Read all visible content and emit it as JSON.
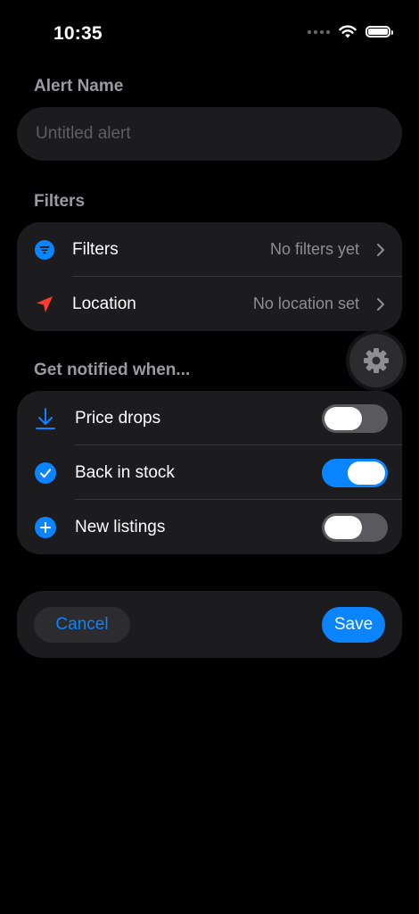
{
  "status_bar": {
    "time": "10:35"
  },
  "alert_name": {
    "label": "Alert Name",
    "placeholder": "Untitled alert",
    "value": ""
  },
  "filters_section": {
    "label": "Filters",
    "rows": [
      {
        "label": "Filters",
        "value": "No filters yet",
        "icon": "filter-icon"
      },
      {
        "label": "Location",
        "value": "No location set",
        "icon": "location-arrow-icon"
      }
    ]
  },
  "notify_section": {
    "label": "Get notified when...",
    "rows": [
      {
        "label": "Price drops",
        "enabled": false,
        "icon": "arrow-down-icon"
      },
      {
        "label": "Back in stock",
        "enabled": true,
        "icon": "checkmark-circle-icon"
      },
      {
        "label": "New listings",
        "enabled": false,
        "icon": "plus-circle-icon"
      }
    ]
  },
  "actions": {
    "cancel_label": "Cancel",
    "save_label": "Save"
  },
  "colors": {
    "accent": "#0a84ff",
    "location_red": "#ff3b30",
    "card_bg": "#1c1c1e"
  }
}
